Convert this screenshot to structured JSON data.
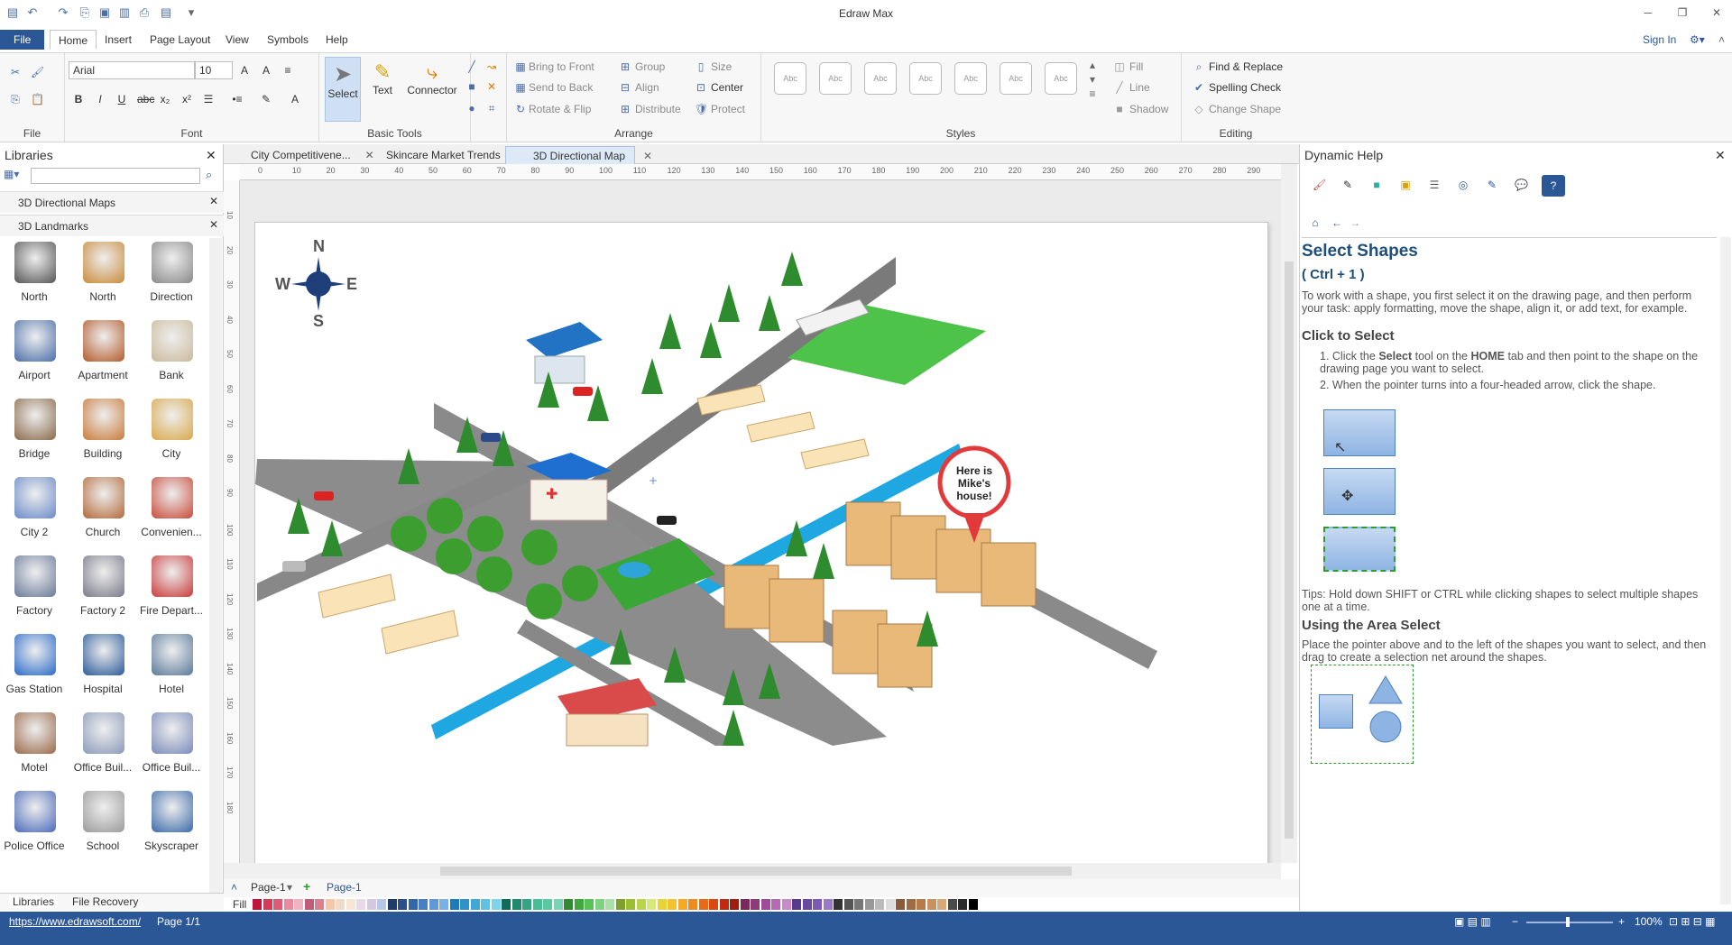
{
  "window": {
    "title": "Edraw Max"
  },
  "menu": {
    "file": "File",
    "tabs": [
      "Home",
      "Insert",
      "Page Layout",
      "View",
      "Symbols",
      "Help"
    ],
    "sign_in": "Sign In"
  },
  "ribbon": {
    "file_group": "File",
    "font": {
      "name": "Arial",
      "size": "10",
      "label": "Font"
    },
    "basic_tools": {
      "label": "Basic Tools",
      "select": "Select",
      "text": "Text",
      "connector": "Connector"
    },
    "arrange": {
      "label": "Arrange",
      "bring_to_front": "Bring to Front",
      "send_to_back": "Send to Back",
      "rotate_flip": "Rotate & Flip",
      "group": "Group",
      "align": "Align",
      "distribute": "Distribute",
      "size": "Size",
      "center": "Center",
      "protect": "Protect"
    },
    "styles": {
      "label": "Styles",
      "sample": "Abc",
      "fill": "Fill",
      "line": "Line",
      "shadow": "Shadow"
    },
    "editing": {
      "label": "Editing",
      "find_replace": "Find & Replace",
      "spelling_check": "Spelling Check",
      "change_shape": "Change Shape"
    }
  },
  "libraries": {
    "title": "Libraries",
    "sections": [
      "3D Directional Maps",
      "3D Landmarks"
    ],
    "shapes": [
      {
        "label": "North",
        "icon": "compass-north-icon"
      },
      {
        "label": "North",
        "icon": "compass-arrow-icon"
      },
      {
        "label": "Direction",
        "icon": "direction-icon"
      },
      {
        "label": "Airport",
        "icon": "airplane-icon"
      },
      {
        "label": "Apartment",
        "icon": "apartment-icon"
      },
      {
        "label": "Bank",
        "icon": "bank-icon"
      },
      {
        "label": "Bridge",
        "icon": "bridge-icon"
      },
      {
        "label": "Building",
        "icon": "building-icon"
      },
      {
        "label": "City",
        "icon": "city-icon"
      },
      {
        "label": "City 2",
        "icon": "city2-icon"
      },
      {
        "label": "Church",
        "icon": "church-icon"
      },
      {
        "label": "Convenien...",
        "icon": "store-icon"
      },
      {
        "label": "Factory",
        "icon": "factory-icon"
      },
      {
        "label": "Factory 2",
        "icon": "factory2-icon"
      },
      {
        "label": "Fire Depart...",
        "icon": "fire-station-icon"
      },
      {
        "label": "Gas Station",
        "icon": "gas-station-icon"
      },
      {
        "label": "Hospital",
        "icon": "hospital-icon"
      },
      {
        "label": "Hotel",
        "icon": "hotel-icon"
      },
      {
        "label": "Motel",
        "icon": "motel-icon"
      },
      {
        "label": "Office Buil...",
        "icon": "office-icon"
      },
      {
        "label": "Office Buil...",
        "icon": "office2-icon"
      },
      {
        "label": "Police Office",
        "icon": "police-icon"
      },
      {
        "label": "School",
        "icon": "school-icon"
      },
      {
        "label": "Skyscraper",
        "icon": "skyscraper-icon"
      }
    ],
    "footer_tabs": [
      "Libraries",
      "File Recovery"
    ]
  },
  "documents": {
    "tabs": [
      "City Competitivene...",
      "Skincare Market Trends",
      "3D Directional Map"
    ],
    "active": "3D Directional Map"
  },
  "ruler": {
    "h_ticks": [
      "0",
      "10",
      "20",
      "30",
      "40",
      "50",
      "60",
      "70",
      "80",
      "90",
      "100",
      "110",
      "120",
      "130",
      "140",
      "150",
      "160",
      "170",
      "180",
      "190",
      "200",
      "210",
      "220",
      "230",
      "240",
      "250",
      "260",
      "270",
      "280",
      "290"
    ],
    "v_ticks": [
      "10",
      "20",
      "30",
      "40",
      "50",
      "60",
      "70",
      "80",
      "90",
      "100",
      "110",
      "120",
      "130",
      "140",
      "150",
      "160",
      "170",
      "180"
    ]
  },
  "canvas": {
    "compass": {
      "n": "N",
      "s": "S",
      "e": "E",
      "w": "W"
    },
    "callout": "Here is Mike's house!"
  },
  "pages": {
    "current": "Page-1",
    "tab": "Page-1"
  },
  "colorbar": {
    "label": "Fill"
  },
  "help": {
    "title": "Dynamic Help",
    "heading": "Select Shapes",
    "shortcut": "( Ctrl + 1 )",
    "intro": "To work with a shape, you first select it on the drawing page, and then perform your task: apply formatting, move the shape, align it, or add text, for example.",
    "click_title": "Click to Select",
    "step1_a": "Click the ",
    "step1_b": "Select",
    "step1_c": " tool on the ",
    "step1_d": "HOME",
    "step1_e": " tab and then point to the shape on the drawing page you want to select.",
    "step2": "When the pointer turns into a four-headed arrow, click the shape.",
    "tips": "Tips: Hold down SHIFT or CTRL while clicking shapes to select multiple shapes one at a time.",
    "area_title": "Using the Area Select",
    "area_text": "Place the pointer above and to the left of the shapes you want to select, and then drag to create a selection net around the shapes."
  },
  "status": {
    "url": "https://www.edrawsoft.com/",
    "page": "Page 1/1",
    "zoom": "100%"
  }
}
